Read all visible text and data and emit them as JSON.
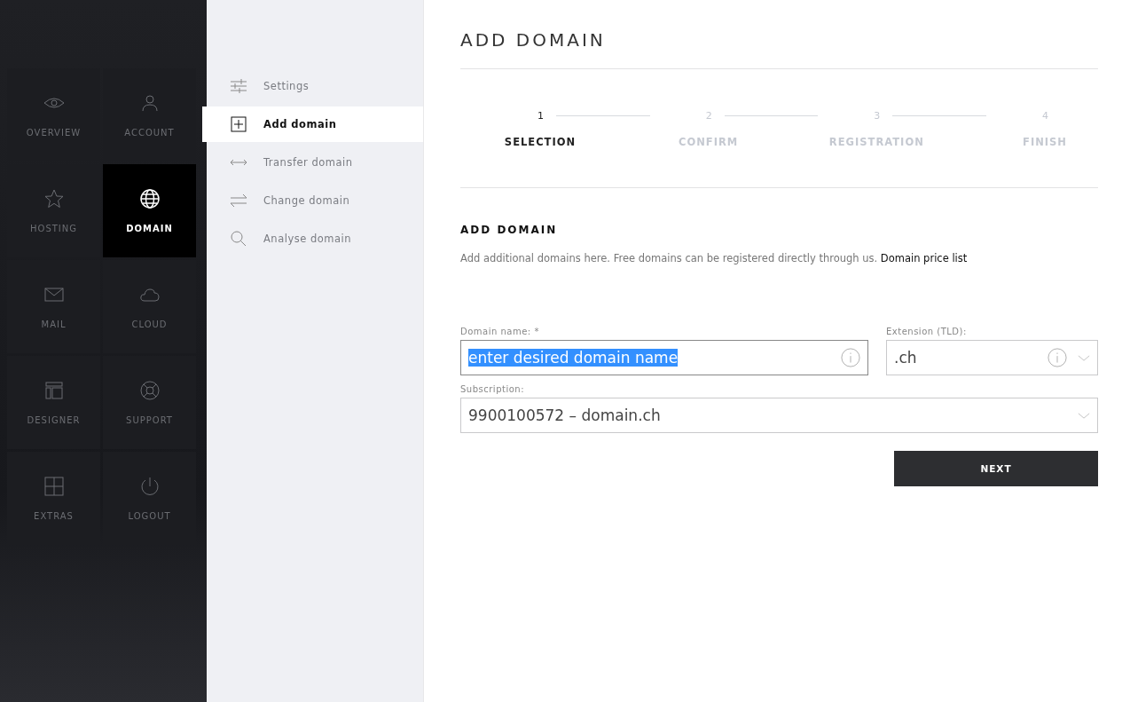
{
  "main_nav": [
    {
      "label": "OVERVIEW",
      "kind": "eye",
      "selected": false
    },
    {
      "label": "ACCOUNT",
      "kind": "person",
      "selected": false
    },
    {
      "label": "HOSTING",
      "kind": "star",
      "selected": false
    },
    {
      "label": "DOMAIN",
      "kind": "globe",
      "selected": true
    },
    {
      "label": "MAIL",
      "kind": "envelope",
      "selected": false
    },
    {
      "label": "CLOUD",
      "kind": "cloud",
      "selected": false
    },
    {
      "label": "DESIGNER",
      "kind": "layout",
      "selected": false
    },
    {
      "label": "SUPPORT",
      "kind": "lifebuoy",
      "selected": false
    },
    {
      "label": "EXTRAS",
      "kind": "plus",
      "selected": false
    },
    {
      "label": "LOGOUT",
      "kind": "power",
      "selected": false
    }
  ],
  "sub_nav": [
    {
      "label": "Settings",
      "kind": "sliders",
      "selected": false
    },
    {
      "label": "Add domain",
      "kind": "plus",
      "selected": true
    },
    {
      "label": "Transfer domain",
      "kind": "double-arrow",
      "selected": false
    },
    {
      "label": "Change domain",
      "kind": "swap",
      "selected": false
    },
    {
      "label": "Analyse domain",
      "kind": "search",
      "selected": false
    }
  ],
  "page_title": "ADD DOMAIN",
  "steps": [
    {
      "number": "1",
      "label": "SELECTION",
      "selected": true
    },
    {
      "number": "2",
      "label": "CONFIRM",
      "selected": false
    },
    {
      "number": "3",
      "label": "REGISTRATION",
      "selected": false
    },
    {
      "number": "4",
      "label": "FINISH",
      "selected": false
    }
  ],
  "section_title": "ADD DOMAIN",
  "intro": {
    "text": "Add additional domains here. Free domains can be registered directly through us.",
    "link": "Domain price list"
  },
  "domain_name": {
    "label": "Domain name: *",
    "value": "enter desired domain name",
    "highlighted": true
  },
  "extension": {
    "label": "Extension (TLD):",
    "value": ".ch"
  },
  "subscription": {
    "label": "Subscription:",
    "value": "9900100572 – domain.ch"
  },
  "next_button": "NEXT"
}
